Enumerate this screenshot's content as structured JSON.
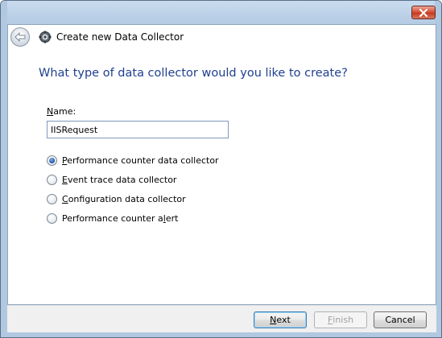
{
  "window": {
    "title": "Create new Data Collector",
    "close_icon": "close-icon",
    "back_icon": "back-arrow-icon",
    "app_icon": "data-collector-gear-icon"
  },
  "main": {
    "question": "What type of data collector would you like to create?",
    "name_label_prefix": "",
    "name_label_access": "N",
    "name_label_rest": "ame:",
    "name_value": "IISRequest"
  },
  "options": [
    {
      "access": "P",
      "rest": "erformance counter data collector",
      "selected": true
    },
    {
      "access": "E",
      "rest": "vent trace data collector",
      "selected": false
    },
    {
      "access": "C",
      "rest": "onfiguration data collector",
      "selected": false
    },
    {
      "before": "Performance counter a",
      "access": "l",
      "rest": "ert",
      "selected": false
    }
  ],
  "buttons": {
    "next_access": "N",
    "next_rest": "ext",
    "finish_access": "F",
    "finish_rest": "inish",
    "cancel": "Cancel"
  },
  "colors": {
    "question_text": "#1f3f8f",
    "frame": "#b1c8e1",
    "close_button": "#c53a22"
  }
}
